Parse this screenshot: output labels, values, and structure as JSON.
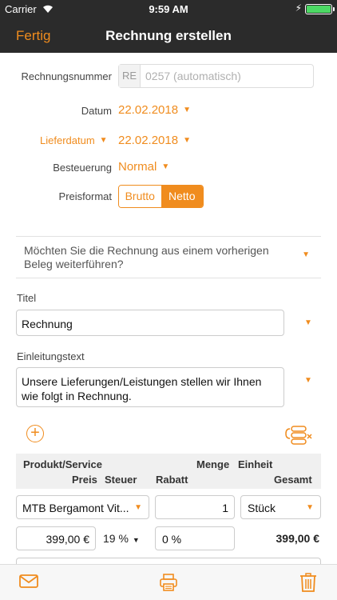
{
  "status": {
    "carrier": "Carrier",
    "time": "9:59 AM"
  },
  "nav": {
    "done": "Fertig",
    "title": "Rechnung erstellen"
  },
  "form": {
    "invoice_number_label": "Rechnungsnummer",
    "invoice_prefix": "RE",
    "invoice_placeholder": "0257 (automatisch)",
    "date_label": "Datum",
    "date_value": "22.02.2018",
    "delivery_label": "Lieferdatum",
    "delivery_value": "22.02.2018",
    "tax_label": "Besteuerung",
    "tax_value": "Normal",
    "price_format_label": "Preisformat",
    "price_options": [
      "Brutto",
      "Netto"
    ],
    "price_selected": "Netto"
  },
  "question": "Möchten Sie die Rechnung aus einem vorherigen Beleg weiterführen?",
  "title_field": {
    "label": "Titel",
    "value": "Rechnung"
  },
  "intro_field": {
    "label": "Einleitungstext",
    "value": "Unsere Lieferungen/Leistungen stellen wir Ihnen wie folgt in Rechnung."
  },
  "table": {
    "headers": {
      "product": "Produkt/Service",
      "quantity": "Menge",
      "unit": "Einheit",
      "price": "Preis",
      "tax": "Steuer",
      "discount": "Rabatt",
      "total": "Gesamt"
    },
    "rows": [
      {
        "product": "MTB Bergamont Vit...",
        "quantity": "1",
        "unit": "Stück",
        "price": "399,00 €",
        "tax": "19 %",
        "discount": "0 %",
        "total": "399,00 €"
      }
    ]
  },
  "colors": {
    "accent": "#f08c1e",
    "bar": "#2b2b2b"
  },
  "icons": [
    "wifi-icon",
    "battery-icon",
    "add-icon",
    "reorder-icon",
    "mail-icon",
    "printer-icon",
    "trash-icon"
  ]
}
